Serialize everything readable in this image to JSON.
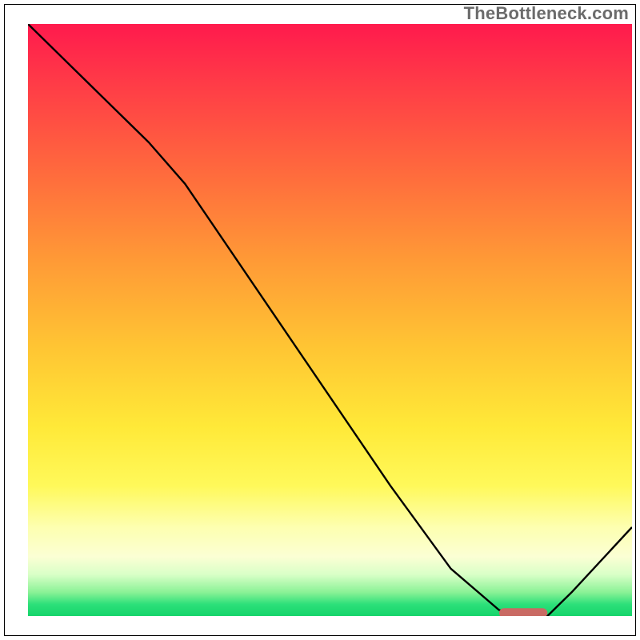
{
  "watermark": "TheBottleneck.com",
  "chart_data": {
    "type": "line",
    "title": "",
    "xlabel": "",
    "ylabel": "",
    "xlim": [
      0,
      100
    ],
    "ylim": [
      0,
      100
    ],
    "grid": false,
    "x": [
      0,
      10,
      20,
      26,
      40,
      50,
      60,
      70,
      78,
      82,
      86,
      90,
      100
    ],
    "y": [
      100,
      90,
      80,
      73,
      52,
      37,
      22,
      8,
      1,
      0,
      0,
      4,
      15
    ],
    "note": "y = 0 is the green bottom edge (bottleneck minimum); y = 100 is the top red edge. Values are read off by vertical height within the colored plot area.",
    "marker": {
      "x_start": 78,
      "x_end": 86,
      "y": 0.5,
      "color": "#c96a63"
    }
  }
}
